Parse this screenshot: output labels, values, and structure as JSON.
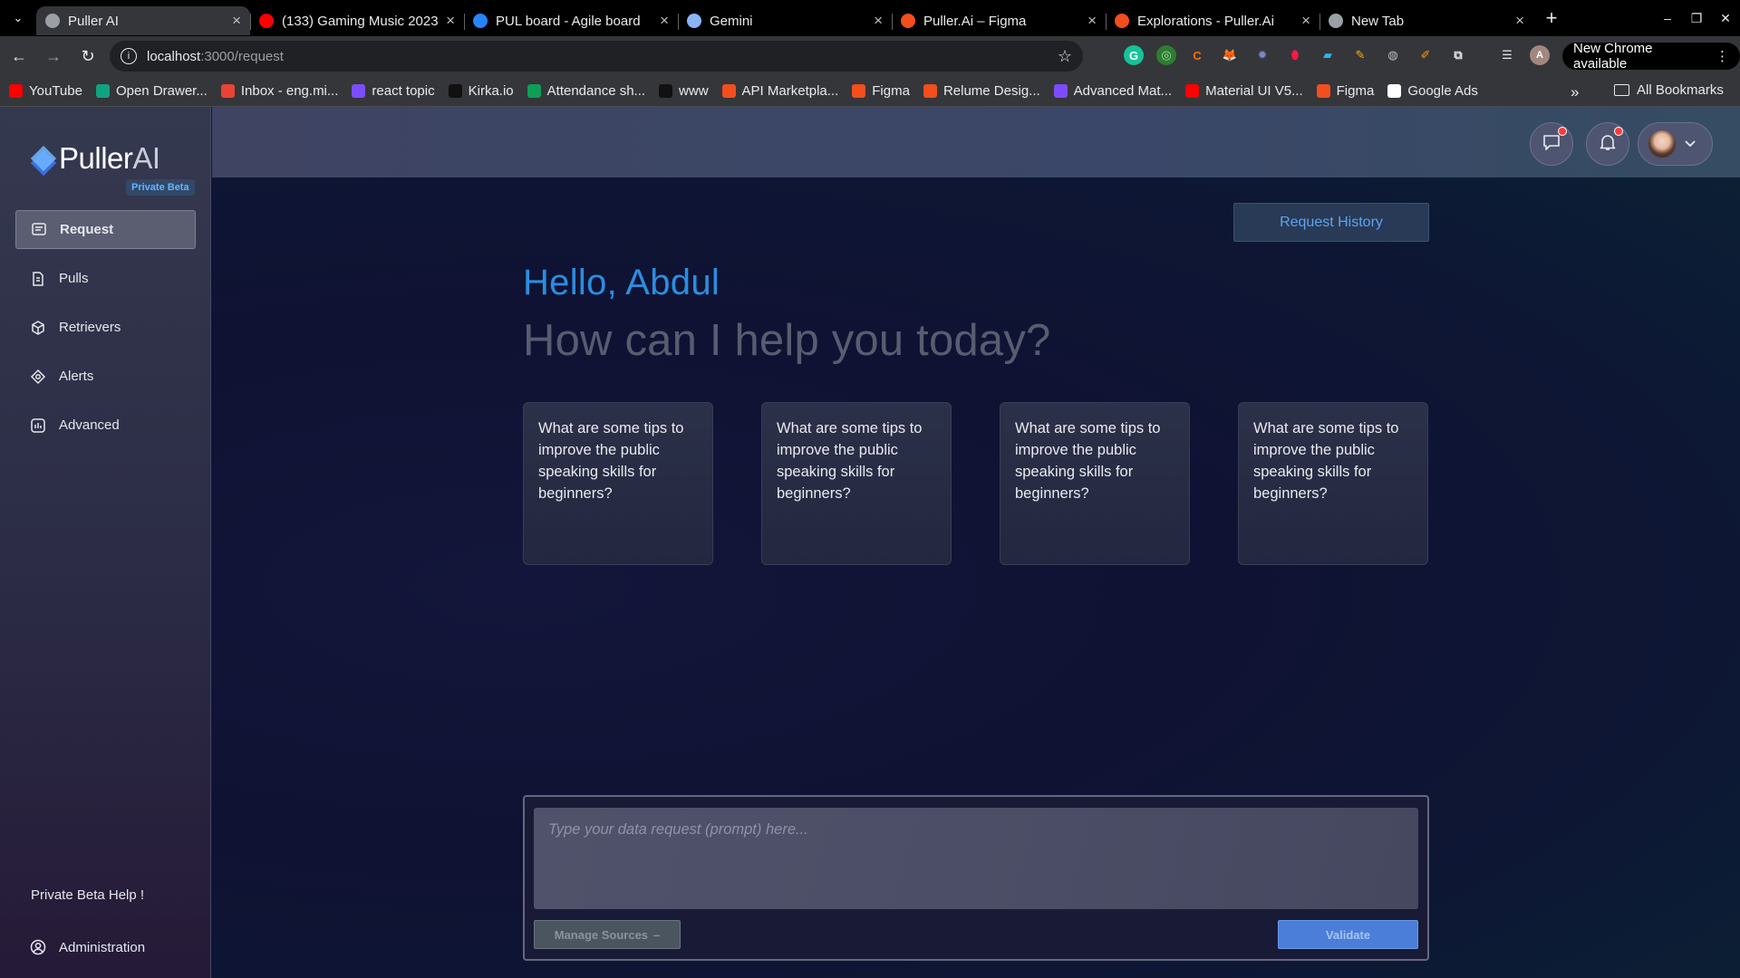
{
  "browser": {
    "tabs": [
      {
        "title": "Puller AI",
        "icon": "globe-icon",
        "active": true
      },
      {
        "title": "(133) Gaming Music 2023",
        "icon": "youtube-icon",
        "color": "#ff0000"
      },
      {
        "title": "PUL board - Agile board",
        "icon": "jira-icon",
        "color": "#2684ff"
      },
      {
        "title": "Gemini",
        "icon": "gemini-sparkle-icon",
        "color": "#8ab4f8"
      },
      {
        "title": "Puller.Ai – Figma",
        "icon": "figma-icon",
        "color": "#f24e1e"
      },
      {
        "title": "Explorations - Puller.Ai",
        "icon": "figma-icon",
        "color": "#f24e1e"
      },
      {
        "title": "New Tab",
        "icon": "chrome-icon"
      }
    ],
    "close_glyph": "×",
    "new_tab_glyph": "+",
    "url_host": "localhost",
    "url_path": ":3000/request",
    "update_label": "New Chrome available",
    "bookmarks": [
      {
        "label": "YouTube",
        "color": "#ff0000"
      },
      {
        "label": "Open Drawer...",
        "color": "#10a37f"
      },
      {
        "label": "Inbox - eng.mi...",
        "color": "#ea4335"
      },
      {
        "label": "react topic",
        "color": "#7c4dff"
      },
      {
        "label": "Kirka.io",
        "color": "#111111"
      },
      {
        "label": "Attendance sh...",
        "color": "#0f9d58"
      },
      {
        "label": "www",
        "color": "#111111"
      },
      {
        "label": "API Marketpla...",
        "color": "#f24e1e"
      },
      {
        "label": "Figma",
        "color": "#f24e1e"
      },
      {
        "label": "Relume Desig...",
        "color": "#f24e1e"
      },
      {
        "label": "Advanced Mat...",
        "color": "#7c4dff"
      },
      {
        "label": "Material UI V5...",
        "color": "#ff0000"
      },
      {
        "label": "Figma",
        "color": "#f24e1e"
      },
      {
        "label": "Google Ads",
        "color": "#ffffff"
      }
    ],
    "bookmarks_more": "»",
    "all_bookmarks": "All Bookmarks"
  },
  "app": {
    "logo_main": "Puller",
    "logo_suffix": "AI",
    "beta_badge": "Private Beta",
    "nav": [
      {
        "label": "Request",
        "icon": "message-square-icon",
        "active": true
      },
      {
        "label": "Pulls",
        "icon": "document-icon"
      },
      {
        "label": "Retrievers",
        "icon": "cube-icon"
      },
      {
        "label": "Alerts",
        "icon": "target-icon"
      },
      {
        "label": "Advanced",
        "icon": "chart-box-icon"
      }
    ],
    "help_label": "Private Beta Help !",
    "admin_label": "Administration",
    "request_history_label": "Request History",
    "greeting": "Hello, Abdul",
    "subheading": "How can I help you today?",
    "suggestions": [
      "What are some tips to improve the public speaking skills for beginners?",
      "What are some tips to improve the public speaking skills for beginners?",
      "What are some tips to improve the public speaking skills for beginners?",
      "What are some tips to improve the public speaking skills for beginners?"
    ],
    "prompt_placeholder": "Type your data request (prompt) here...",
    "prompt_value": "",
    "manage_sources_label": "Manage Sources",
    "manage_sources_glyph": "–",
    "validate_label": "Validate",
    "colors": {
      "accent": "#2a8ee0",
      "validate": "#4a7ed8",
      "notification_dot": "#ff3b3b"
    }
  }
}
